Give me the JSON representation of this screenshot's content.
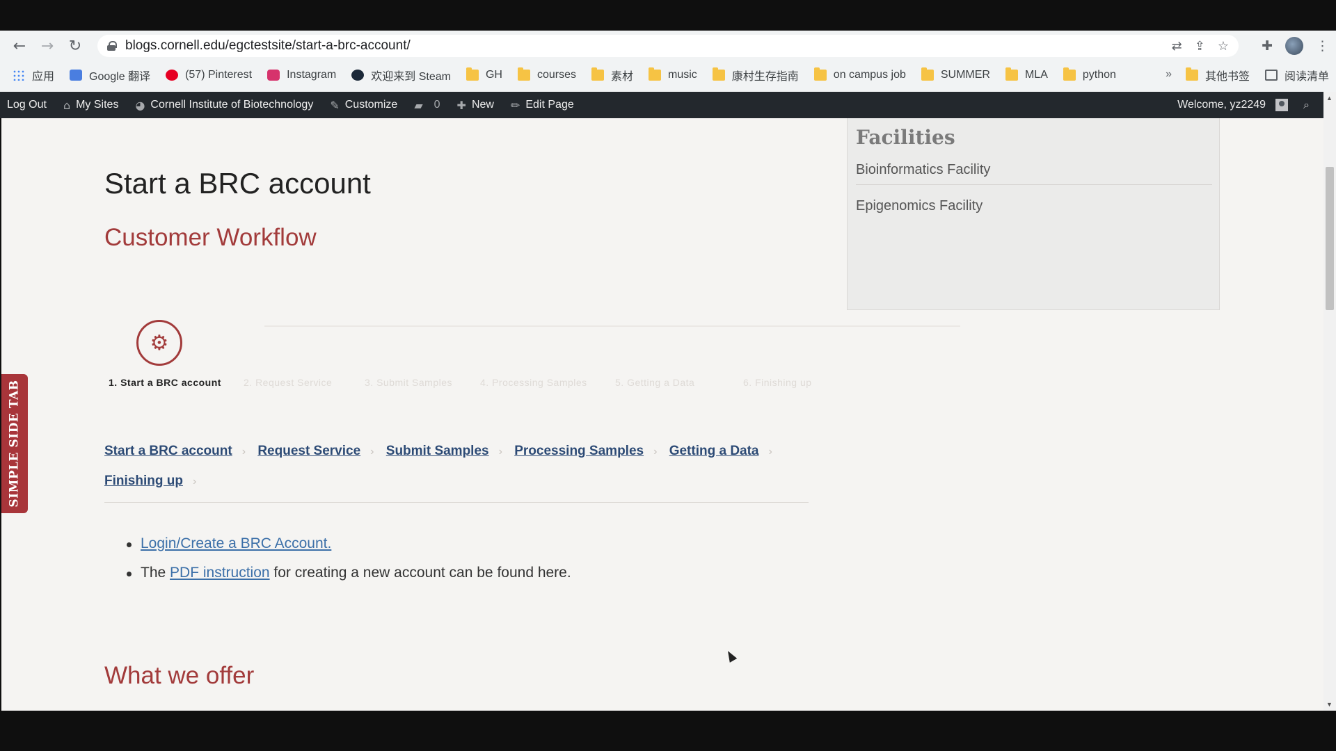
{
  "browser": {
    "url": "blogs.cornell.edu/egctestsite/start-a-brc-account/",
    "nav": {
      "back_icon": "←",
      "forward_icon": "→",
      "reload_icon": "↻"
    },
    "bookmarks": [
      {
        "label": "应用",
        "icon": "apps-icon"
      },
      {
        "label": "Google 翻译",
        "icon": "google-translate-icon"
      },
      {
        "label": "(57) Pinterest",
        "icon": "pinterest-icon"
      },
      {
        "label": "Instagram",
        "icon": "instagram-icon"
      },
      {
        "label": "欢迎来到 Steam",
        "icon": "steam-icon"
      },
      {
        "label": "GH",
        "icon": "folder-icon"
      },
      {
        "label": "courses",
        "icon": "folder-icon"
      },
      {
        "label": "素材",
        "icon": "folder-icon"
      },
      {
        "label": "music",
        "icon": "folder-icon"
      },
      {
        "label": "康村生存指南",
        "icon": "folder-icon"
      },
      {
        "label": "on campus job",
        "icon": "folder-icon"
      },
      {
        "label": "SUMMER",
        "icon": "folder-icon"
      },
      {
        "label": "MLA",
        "icon": "folder-icon"
      },
      {
        "label": "python",
        "icon": "folder-icon"
      }
    ],
    "bookmarks_more": "»",
    "other_bookmarks": "其他书签",
    "reading_list": "阅读清单"
  },
  "admin_bar": {
    "log_out": "Log Out",
    "my_sites": "My Sites",
    "site_name": "Cornell Institute of Biotechnology",
    "customize": "Customize",
    "comments_count": "0",
    "new": "New",
    "edit_page": "Edit Page",
    "welcome": "Welcome, yz2249"
  },
  "page": {
    "title": "Start a BRC account",
    "section1": "Customer Workflow",
    "steps": [
      {
        "label": "1. Start  a  BRC  account",
        "active": true
      },
      {
        "label": "2. Request  Service",
        "active": false
      },
      {
        "label": "3. Submit  Samples",
        "active": false
      },
      {
        "label": "4. Processing  Samples",
        "active": false
      },
      {
        "label": "5. Getting  a  Data",
        "active": false
      },
      {
        "label": "6. Finishing  up",
        "active": false
      }
    ],
    "breadcrumb": [
      "Start a BRC account",
      "Request Service",
      "Submit Samples",
      "Processing Samples",
      "Getting a Data",
      "Finishing up"
    ],
    "crumb_sep": "›",
    "list": {
      "item1_link": "Login/Create a BRC Account.",
      "item2_prefix": "The ",
      "item2_link": "PDF instruction",
      "item2_suffix": " for creating a new account can be found here."
    },
    "section2": "What we offer"
  },
  "sidebar": {
    "title": "Facilities",
    "items": [
      "Bioinformatics Facility",
      "Epigenomics Facility"
    ]
  },
  "side_tab": {
    "label": "SIMPLE SIDE TAB"
  },
  "colors": {
    "accent": "#a23b3b",
    "link": "#2c4a75",
    "adminbar": "#23282d"
  }
}
